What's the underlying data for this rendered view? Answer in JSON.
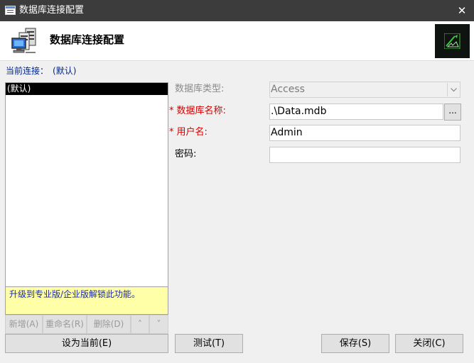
{
  "window": {
    "title": "数据库连接配置",
    "close_glyph": "✕"
  },
  "header": {
    "title": "数据库连接配置"
  },
  "current_connection": {
    "label": "当前连接：",
    "value": "(默认)"
  },
  "connection_list": {
    "items": [
      "(默认)"
    ]
  },
  "upgrade_notice": "升级到专业版/企业版解锁此功能。",
  "list_buttons": {
    "add": "新增(A)",
    "rename": "重命名(R)",
    "delete": "删除(D)",
    "up": "˄",
    "down": "˅"
  },
  "set_current_button": "设为当前(E)",
  "form": {
    "db_type": {
      "label": "数据库类型:",
      "value": "Access",
      "required": false,
      "disabled": true
    },
    "db_name": {
      "label": "数据库名称:",
      "value": ".\\Data.mdb",
      "required": true,
      "browse": "..."
    },
    "username": {
      "label": "用户名:",
      "value": "Admin",
      "required": true
    },
    "password": {
      "label": "密码:",
      "value": "",
      "required": false
    }
  },
  "required_mark": "*",
  "buttons": {
    "test": "测试(T)",
    "save": "保存(S)",
    "close": "关闭(C)"
  },
  "icons": {
    "window_icon": "db-window-icon",
    "header_icon": "database-servers-icon",
    "logo": "app-logo-icon",
    "dropdown": "chevron-down-icon"
  },
  "colors": {
    "titlebar": "#3c3c3c",
    "current_connection": "#00238c",
    "required": "#d80000",
    "upgrade_bg": "#ffffa8",
    "upgrade_text": "#1a2aa8",
    "logo_bg": "#101410",
    "logo_fg": "#3ec63e"
  }
}
